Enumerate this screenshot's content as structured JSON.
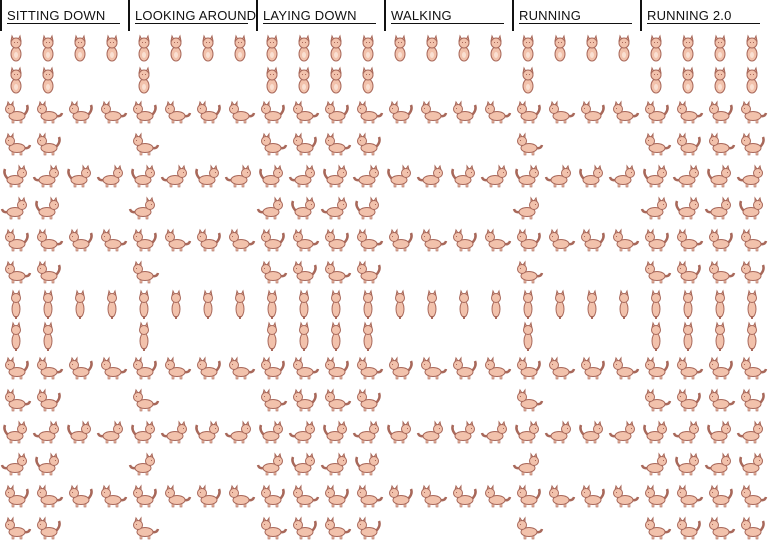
{
  "sheet": {
    "sections": [
      {
        "id": "sitting-down",
        "title": "SITTING DOWN",
        "cols": 4,
        "rows": 16,
        "frames": [
          4,
          2,
          4,
          2,
          4,
          2,
          4,
          2,
          4,
          2,
          4,
          2,
          4,
          2,
          4,
          2
        ]
      },
      {
        "id": "looking-around",
        "title": "LOOKING AROUND",
        "cols": 4,
        "rows": 16,
        "frames": [
          4,
          1,
          4,
          1,
          4,
          1,
          4,
          1,
          4,
          1,
          4,
          1,
          4,
          1,
          4,
          1
        ]
      },
      {
        "id": "laying-down",
        "title": "LAYING DOWN",
        "cols": 4,
        "rows": 16,
        "frames": [
          4,
          4,
          4,
          4,
          4,
          4,
          4,
          4,
          4,
          4,
          4,
          4,
          4,
          4,
          4,
          4
        ]
      },
      {
        "id": "walking",
        "title": "WALKING",
        "cols": 4,
        "rows": 16,
        "frames": [
          4,
          0,
          4,
          0,
          4,
          0,
          4,
          0,
          4,
          0,
          4,
          0,
          4,
          0,
          4,
          0
        ]
      },
      {
        "id": "running",
        "title": "RUNNING",
        "cols": 4,
        "rows": 16,
        "frames": [
          4,
          1,
          4,
          1,
          4,
          1,
          4,
          1,
          4,
          1,
          4,
          1,
          4,
          1,
          4,
          1
        ]
      },
      {
        "id": "running-2",
        "title": "RUNNING 2.0",
        "cols": 4,
        "rows": 16,
        "frames": [
          4,
          4,
          4,
          4,
          4,
          4,
          4,
          4,
          4,
          4,
          4,
          4,
          4,
          4,
          4,
          4
        ]
      }
    ],
    "colors": {
      "fur": "#f2c2ac",
      "fur_light": "#fae0d2",
      "outline": "#a8685a",
      "header_text": "#111111",
      "background": "#ffffff"
    },
    "row_facings": [
      "front",
      "front",
      "side",
      "side",
      "side",
      "side",
      "side",
      "side",
      "back",
      "back",
      "side",
      "side",
      "side",
      "side",
      "side",
      "side"
    ]
  }
}
